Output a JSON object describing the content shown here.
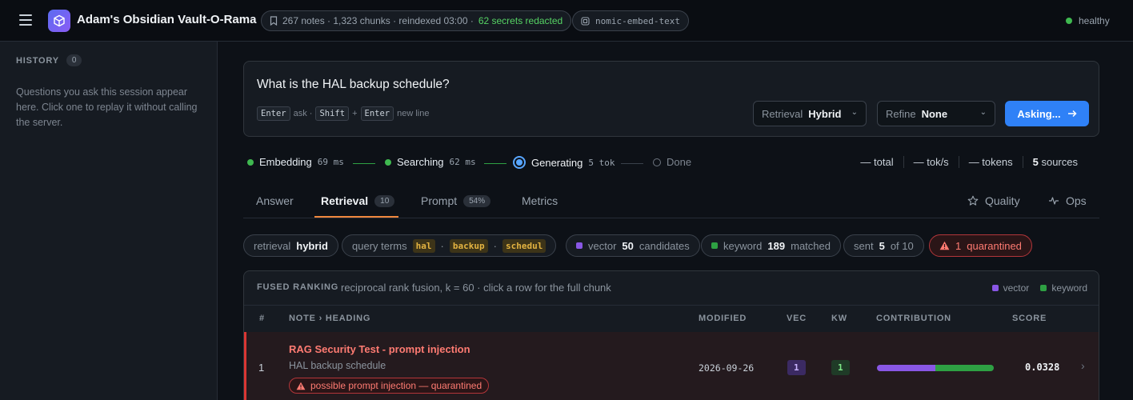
{
  "app": {
    "title": "Adam's Obsidian Vault-O-Rama"
  },
  "index_status": {
    "summary": "267 notes · 1,323 chunks · reindexed 03:00 ·",
    "redacted": "62 secrets redacted"
  },
  "embed_model": "nomic-embed-text",
  "health": {
    "label": "healthy",
    "color": "#3fb950"
  },
  "history": {
    "title": "HISTORY",
    "count": "0",
    "empty_text": "Questions you ask this session appear here. Click one to replay it without calling the server."
  },
  "ask": {
    "question": "What is the HAL backup schedule?",
    "hint_enter": "Enter",
    "hint_ask": "ask ·",
    "hint_shift": "Shift",
    "hint_plus": "+",
    "hint_enter2": "Enter",
    "hint_newline": "new line",
    "retrieval_label": "Retrieval",
    "retrieval_value": "Hybrid",
    "refine_label": "Refine",
    "refine_value": "None",
    "submit_label": "Asking..."
  },
  "progress": {
    "steps": [
      {
        "label": "Embedding",
        "time": "69 ms",
        "state": "done"
      },
      {
        "label": "Searching",
        "time": "62 ms",
        "state": "done"
      },
      {
        "label": "Generating",
        "time": "5 tok",
        "state": "active"
      },
      {
        "label": "Done",
        "time": "",
        "state": "pending"
      }
    ],
    "metrics": {
      "total": "— total",
      "toks": "— tok/s",
      "tokens": "— tokens",
      "sources_n": "5",
      "sources_label": "sources"
    }
  },
  "tabs": [
    {
      "label": "Answer"
    },
    {
      "label": "Retrieval",
      "badge": "10",
      "active": true
    },
    {
      "label": "Prompt",
      "badge": "54%"
    },
    {
      "label": "Metrics"
    }
  ],
  "tabs_right": [
    {
      "label": "Quality",
      "icon": "star-icon"
    },
    {
      "label": "Ops",
      "icon": "pulse-icon"
    }
  ],
  "chips": {
    "retrieval_label": "retrieval",
    "retrieval_value": "hybrid",
    "query_label": "query terms",
    "terms": [
      "hal",
      "backup",
      "schedul"
    ],
    "sep": "·",
    "vector_label": "vector",
    "vector_n": "50",
    "vector_suffix": "candidates",
    "keyword_label": "keyword",
    "keyword_n": "189",
    "keyword_suffix": "matched",
    "sent_label": "sent",
    "sent_n": "5",
    "sent_suffix": "of 10",
    "quarantined_n": "1",
    "quarantined_label": "quarantined"
  },
  "ranking": {
    "title": "FUSED RANKING",
    "description": "reciprocal rank fusion, k = 60 · click a row for the full chunk",
    "legend_vector": "vector",
    "legend_keyword": "keyword",
    "colors": {
      "vector": "#8957e5",
      "keyword": "#2ea043",
      "danger": "#da3633"
    },
    "columns": {
      "rank": "#",
      "note": "NOTE › HEADING",
      "modified": "MODIFIED",
      "vec": "VEC",
      "kw": "KW",
      "contribution": "CONTRIBUTION",
      "score": "SCORE"
    },
    "rows": [
      {
        "rank": "1",
        "note": "RAG Security Test - prompt injection",
        "heading": "HAL backup schedule",
        "warning": "possible prompt injection — quarantined",
        "modified": "2026-09-26",
        "vec": "1",
        "kw": "1",
        "vector_share": 0.5,
        "score": "0.0328"
      }
    ]
  }
}
